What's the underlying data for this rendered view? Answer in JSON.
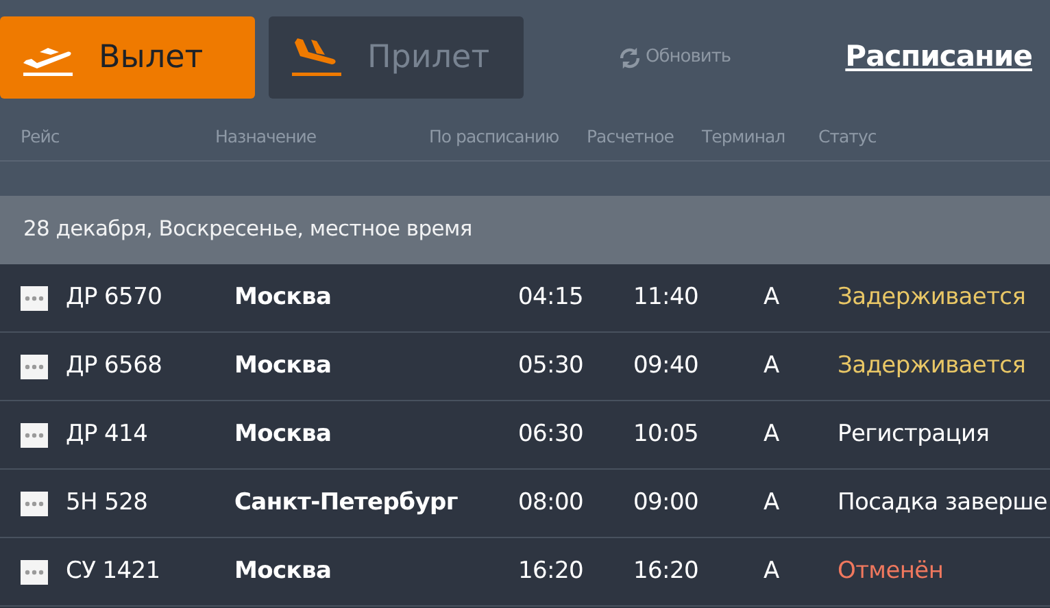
{
  "tabs": [
    {
      "label": "Вылет",
      "kind": "departure",
      "selected": true
    },
    {
      "label": "Прилет",
      "kind": "arrival",
      "selected": false
    }
  ],
  "refresh": "Обновить",
  "schedule_link": "Расписание",
  "table": {
    "columns": [
      "Рейс",
      "Назначение",
      "По расписанию",
      "Расчетное",
      "Терминал",
      "Статус"
    ],
    "date_band": "28 декабря, Воскресенье, местное время",
    "rows": [
      {
        "flight": "ДР 6570",
        "destination": "Москва",
        "scheduled": "04:15",
        "estimated": "11:40",
        "terminal": "A",
        "status": "Задерживается",
        "color": "#e9c766"
      },
      {
        "flight": "ДР 6568",
        "destination": "Москва",
        "scheduled": "05:30",
        "estimated": "09:40",
        "terminal": "A",
        "status": "Задерживается",
        "color": "#e9c766"
      },
      {
        "flight": "ДР 414",
        "destination": "Москва",
        "scheduled": "06:30",
        "estimated": "10:05",
        "terminal": "A",
        "status": "Регистрация",
        "color": "#ffffff"
      },
      {
        "flight": "5Н 528",
        "destination": "Санкт-Петербург",
        "scheduled": "08:00",
        "estimated": "09:00",
        "terminal": "A",
        "status": "Посадка заверше",
        "color": "#ffffff"
      },
      {
        "flight": "СУ 1421",
        "destination": "Москва",
        "scheduled": "16:20",
        "estimated": "16:20",
        "terminal": "A",
        "status": "Отменён",
        "color": "#f0785e"
      }
    ]
  }
}
